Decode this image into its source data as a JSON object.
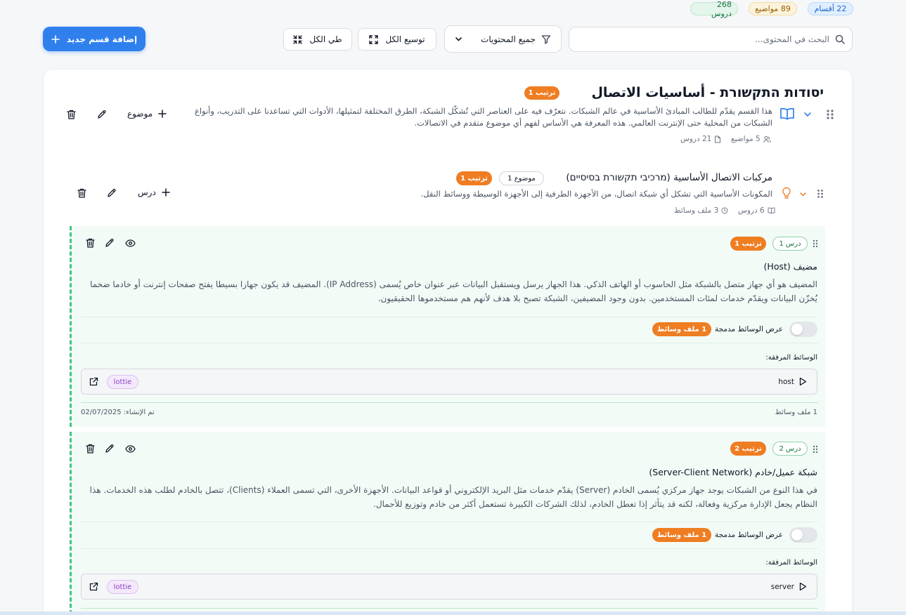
{
  "stats": {
    "sections": "22 أقسام",
    "topics": "89 مواضيع",
    "lessons": "268 دروس"
  },
  "toolbar": {
    "search_placeholder": "البحث في المحتوى...",
    "filter_label": "جميع المحتويات",
    "expand_all": "توسيع الكل",
    "collapse_all": "طي الكل",
    "add_section": "إضافة قسم جديد"
  },
  "section": {
    "title": "יסודות התקשורת - أساسيات الاتصال",
    "order_badge": "ترتيب 1",
    "description": "هذا القسم يقدّم للطالب المبادئ الأساسية في عالم الشبكات. نتعرّف فيه على العناصر التي تُشكّل الشبكة، الطرق المختلفة لتمثيلها، الأدوات التي تساعدنا على التدريب، وأنواع الشبكات من المحلية حتى الإنترنت العالمي. هذه المعرفة هي الأساس لفهم أي موضوع متقدم في الاتصالات.",
    "topics_count": "5 مواضيع",
    "lessons_count": "21 دروس",
    "add_topic_label": "موضوع"
  },
  "topic": {
    "title": "مركبات الاتصال الأساسية (מרכיבי תקשורת בסיסיים)",
    "type_badge": "موضوع 1",
    "order_badge": "ترتيب 1",
    "description": "المكونات الأساسية التي تشكل أي شبكة اتصال، من الأجهزة الطرفية إلى الأجهزة الوسيطة ووسائط النقل.",
    "lessons_count": "6 دروس",
    "media_count": "3 ملف وسائط",
    "add_lesson_label": "درس"
  },
  "lessons": [
    {
      "lesson_badge": "درس 1",
      "order_badge": "ترتيب 1",
      "title": "مضيف (Host)",
      "body": "المضيف هو أي جهاز متصل بالشبكة مثل الحاسوب أو الهاتف الذكي. هذا الجهاز يرسل ويستقبل البيانات عبر عنوان خاص يُسمى (IP Address). المضيف قد يكون جهازا بسيطا يفتح صفحات إنترنت أو خادما ضخما يُخزّن البيانات ويقدّم خدمات لمئات المستخدمين. بدون وجود المضيفين، الشبكة تصبح بلا هدف لأنهم هم مستخدموها الحقيقيون.",
      "toggle_label": "عرض الوسائط مدمجة",
      "media_badge": "1 ملف وسائط",
      "attached_label": "الوسائط المرفقة:",
      "media_name": "host",
      "media_type": "lottie",
      "footer_count": "1 ملف وسائط",
      "created": "تم الإنشاء: 02/07/2025"
    },
    {
      "lesson_badge": "درس 2",
      "order_badge": "ترتيب 2",
      "title": "شبكة عميل/خادم (Server-Client Network)",
      "body": "في هذا النوع من الشبكات يوجد جهاز مركزي يُسمى الخادم (Server) يقدّم خدمات مثل البريد الإلكتروني أو قواعد البيانات. الأجهزة الأخرى، التي تسمى العملاء (Clients)، تتصل بالخادم لطلب هذه الخدمات. هذا النظام يجعل الإدارة مركزية وفعالة، لكنه قد يتأثر إذا تعطل الخادم، لذلك الشركات الكبيرة تستعمل أكثر من خادم وتوزيع للأحمال.",
      "toggle_label": "عرض الوسائط مدمجة",
      "media_badge": "1 ملف وسائط",
      "attached_label": "الوسائط المرفقة:",
      "media_name": "server",
      "media_type": "lottie"
    }
  ],
  "colors": {
    "primary": "#2f80ed",
    "orange": "#ef7d22",
    "green_dash": "#3ec782"
  }
}
